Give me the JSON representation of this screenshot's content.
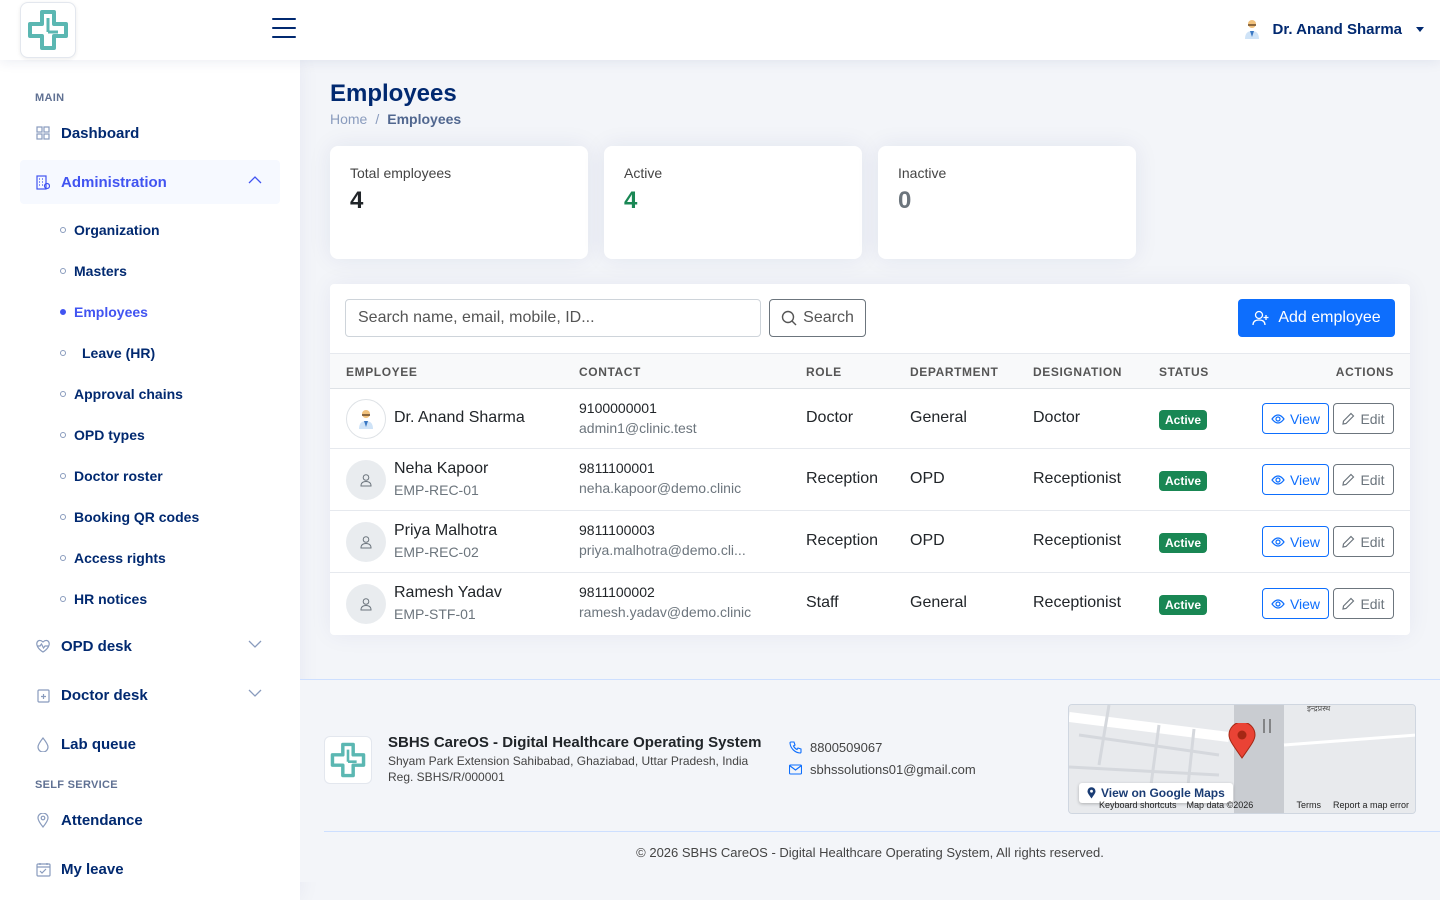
{
  "header": {
    "user_name": "Dr. Anand Sharma"
  },
  "sidebar": {
    "sections": {
      "main": "MAIN",
      "self_service": "SELF SERVICE"
    },
    "nav": {
      "dashboard": "Dashboard",
      "administration": "Administration",
      "opd_desk": "OPD desk",
      "doctor_desk": "Doctor desk",
      "lab_queue": "Lab queue",
      "attendance": "Attendance",
      "my_leave": "My leave"
    },
    "admin_items": [
      "Organization",
      "Masters",
      "Employees",
      "Leave (HR)",
      "Approval chains",
      "OPD types",
      "Doctor roster",
      "Booking QR codes",
      "Access rights",
      "HR notices"
    ]
  },
  "page": {
    "title": "Employees",
    "breadcrumb": {
      "home": "Home",
      "separator": "/",
      "current": "Employees"
    }
  },
  "stats": {
    "total_label": "Total employees",
    "total_value": "4",
    "active_label": "Active",
    "active_value": "4",
    "inactive_label": "Inactive",
    "inactive_value": "0"
  },
  "toolbar": {
    "search_placeholder": "Search name, email, mobile, ID...",
    "search_label": "Search",
    "add_label": "Add employee"
  },
  "table": {
    "columns": [
      "EMPLOYEE",
      "CONTACT",
      "ROLE",
      "DEPARTMENT",
      "DESIGNATION",
      "STATUS",
      "ACTIONS"
    ],
    "view_label": "View",
    "edit_label": "Edit",
    "rows": [
      {
        "name": "Dr. Anand Sharma",
        "emp_id": "",
        "phone": "9100000001",
        "email": "admin1@clinic.test",
        "role": "Doctor",
        "department": "General",
        "designation": "Doctor",
        "status": "Active"
      },
      {
        "name": "Neha Kapoor",
        "emp_id": "EMP-REC-01",
        "phone": "9811100001",
        "email": "neha.kapoor@demo.clinic",
        "role": "Reception",
        "department": "OPD",
        "designation": "Receptionist",
        "status": "Active"
      },
      {
        "name": "Priya Malhotra",
        "emp_id": "EMP-REC-02",
        "phone": "9811100003",
        "email": "priya.malhotra@demo.cli...",
        "role": "Reception",
        "department": "OPD",
        "designation": "Receptionist",
        "status": "Active"
      },
      {
        "name": "Ramesh Yadav",
        "emp_id": "EMP-STF-01",
        "phone": "9811100002",
        "email": "ramesh.yadav@demo.clinic",
        "role": "Staff",
        "department": "General",
        "designation": "Receptionist",
        "status": "Active"
      }
    ]
  },
  "footer": {
    "brand": "SBHS CareOS - Digital Healthcare Operating System",
    "address": "Shyam Park Extension Sahibabad, Ghaziabad, Uttar Pradesh, India",
    "reg": "Reg. SBHS/R/000001",
    "phone": "8800509067",
    "email": "sbhssolutions01@gmail.com",
    "map_link": "View on Google Maps",
    "map_shortcuts": "Keyboard shortcuts",
    "map_data": "Map data ©2026",
    "map_terms": "Terms",
    "map_report": "Report a map error",
    "map_label": "इन्द्रप्रस्थ",
    "copyright": "© 2026 SBHS CareOS - Digital Healthcare Operating System, All rights reserved."
  },
  "colors": {
    "brand_logo": "#5bb7b2",
    "primary": "#0d6efd",
    "nav_active": "#4154f1",
    "success": "#198754",
    "navy": "#012970"
  }
}
